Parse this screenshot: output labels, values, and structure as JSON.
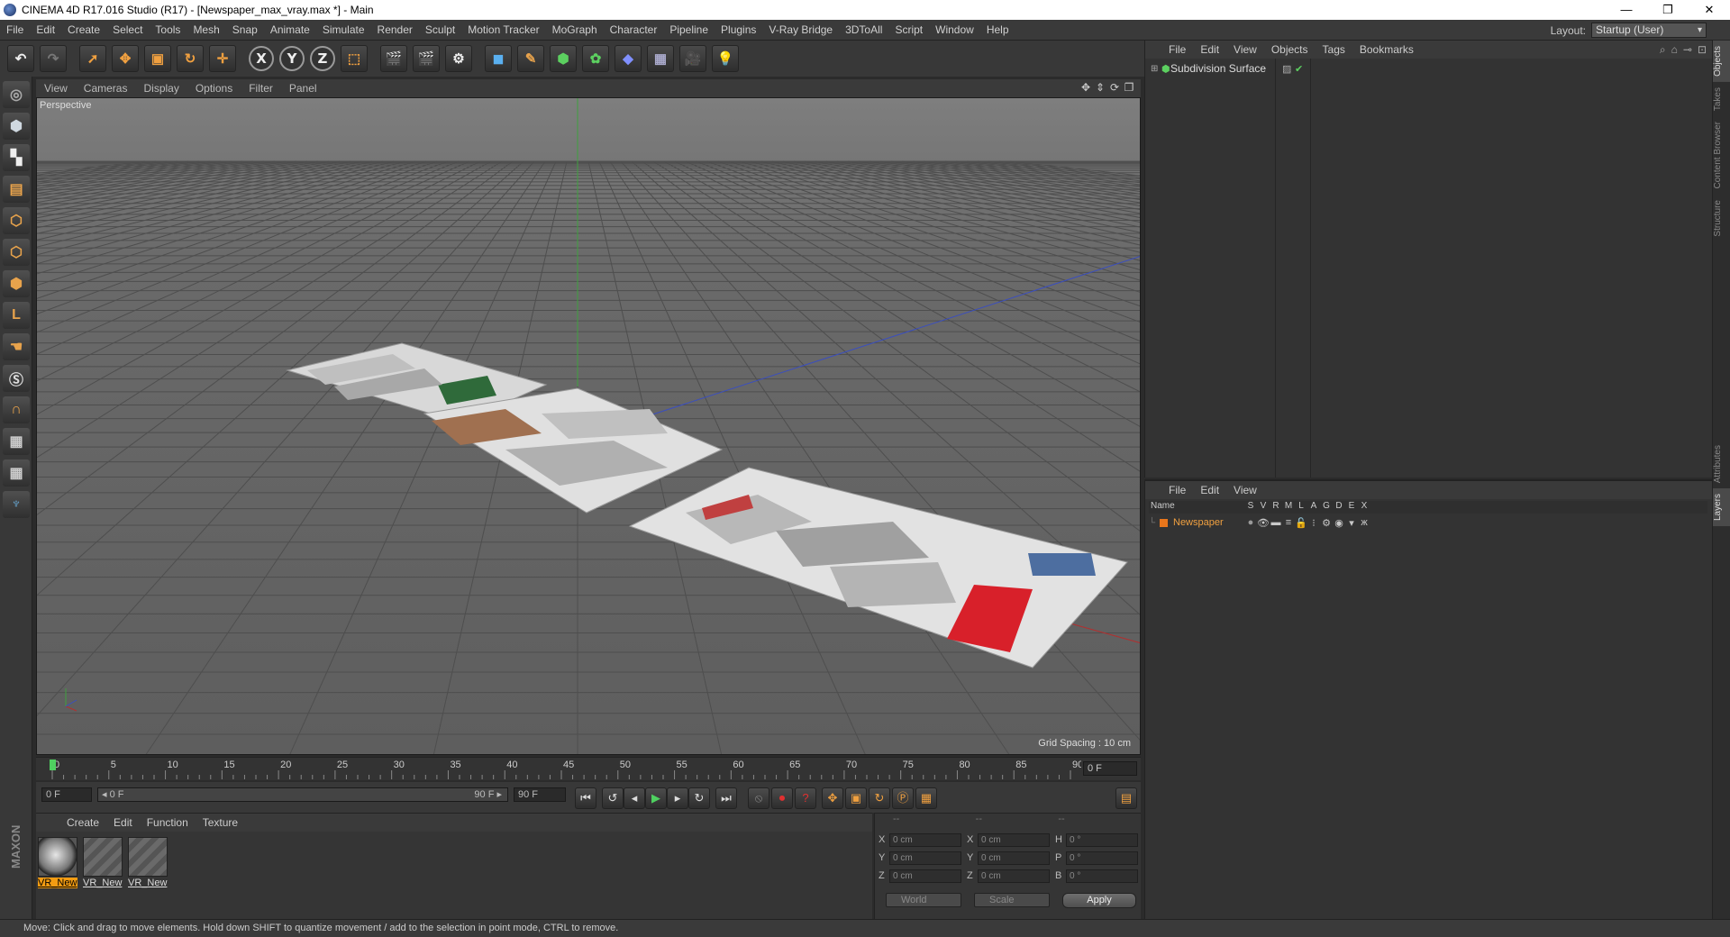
{
  "window": {
    "title": "CINEMA 4D R17.016 Studio (R17) - [Newspaper_max_vray.max *] - Main",
    "minimize": "—",
    "maximize": "❐",
    "close": "✕"
  },
  "menu": [
    "File",
    "Edit",
    "Create",
    "Select",
    "Tools",
    "Mesh",
    "Snap",
    "Animate",
    "Simulate",
    "Render",
    "Sculpt",
    "Motion Tracker",
    "MoGraph",
    "Character",
    "Pipeline",
    "Plugins",
    "V-Ray Bridge",
    "3DToAll",
    "Script",
    "Window",
    "Help"
  ],
  "layout": {
    "label": "Layout:",
    "value": "Startup (User)"
  },
  "toolbar": {
    "x": "X",
    "y": "Y",
    "z": "Z"
  },
  "viewport": {
    "menu": [
      "View",
      "Cameras",
      "Display",
      "Options",
      "Filter",
      "Panel"
    ],
    "label": "Perspective",
    "grid_spacing": "Grid Spacing : 10 cm"
  },
  "timeline": {
    "ticks": [
      "0",
      "5",
      "10",
      "15",
      "20",
      "25",
      "30",
      "35",
      "40",
      "45",
      "50",
      "55",
      "60",
      "65",
      "70",
      "75",
      "80",
      "85",
      "90"
    ],
    "current_frame": "0 F"
  },
  "transport": {
    "start": "0 F",
    "range_start": "◂ 0 F",
    "range_end": "90 F ▸",
    "end": "90 F"
  },
  "material_manager": {
    "menu": [
      "Create",
      "Edit",
      "Function",
      "Texture"
    ],
    "materials": [
      "VR_New",
      "VR_New",
      "VR_New"
    ]
  },
  "coordinates": {
    "headers": [
      "--",
      "--",
      "--"
    ],
    "rows": [
      {
        "a": "X",
        "v1": "0 cm",
        "b": "X",
        "v2": "0 cm",
        "c": "H",
        "v3": "0 °"
      },
      {
        "a": "Y",
        "v1": "0 cm",
        "b": "Y",
        "v2": "0 cm",
        "c": "P",
        "v3": "0 °"
      },
      {
        "a": "Z",
        "v1": "0 cm",
        "b": "Z",
        "v2": "0 cm",
        "c": "B",
        "v3": "0 °"
      }
    ],
    "world": "World",
    "scale": "Scale",
    "apply": "Apply"
  },
  "object_manager": {
    "menu": [
      "File",
      "Edit",
      "View",
      "Objects",
      "Tags",
      "Bookmarks"
    ],
    "object": "Subdivision Surface"
  },
  "layer_manager": {
    "menu": [
      "File",
      "Edit",
      "View"
    ],
    "columns": [
      "Name",
      "S",
      "V",
      "R",
      "M",
      "L",
      "A",
      "G",
      "D",
      "E",
      "X"
    ],
    "layer": "Newspaper",
    "layer_color": "#e8761c"
  },
  "side_tabs": [
    "Objects",
    "Takes",
    "Content Browser",
    "Structure",
    "Attributes",
    "Layers"
  ],
  "brand": "MAXON CINEMA 4D",
  "status": "Move: Click and drag to move elements. Hold down SHIFT to quantize movement / add to the selection in point mode, CTRL to remove."
}
